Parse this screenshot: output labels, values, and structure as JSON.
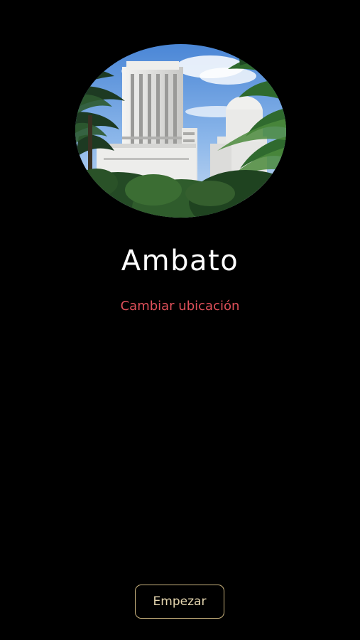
{
  "location": {
    "city_name": "Ambato",
    "change_location_label": "Cambiar ubicación"
  },
  "photo": {
    "subject": "city-landmark-photo"
  },
  "actions": {
    "start_label": "Empezar"
  },
  "colors": {
    "background": "#000000",
    "city_name_text": "#ffffff",
    "link_accent": "#e0505a",
    "button_border": "#c9b37e",
    "button_text": "#e6d7b0"
  }
}
